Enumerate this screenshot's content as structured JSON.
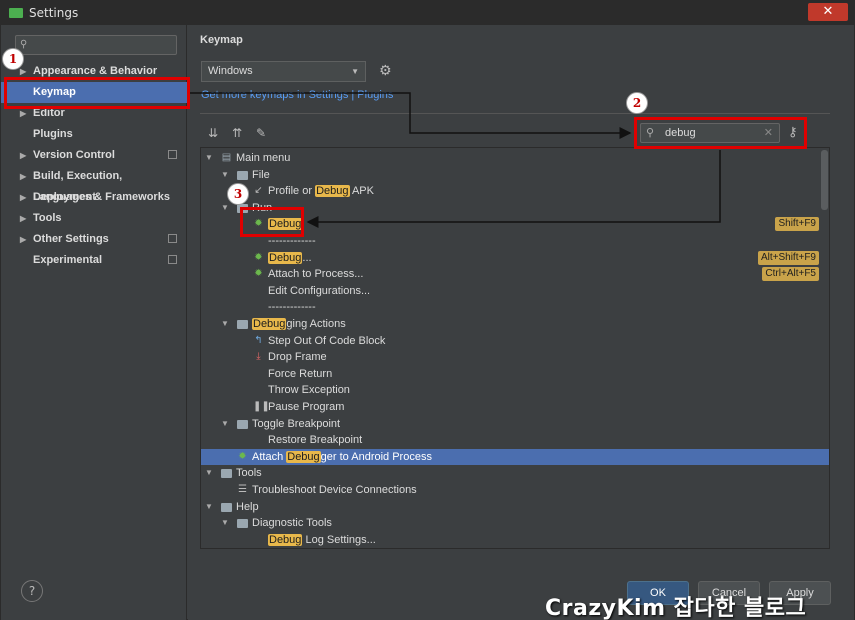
{
  "window": {
    "title": "Settings",
    "close_label": "✕"
  },
  "sidebar": {
    "search_placeholder": "",
    "items": [
      {
        "label": "Appearance & Behavior",
        "expandable": true,
        "project": false
      },
      {
        "label": "Keymap",
        "expandable": false,
        "project": false,
        "selected": true
      },
      {
        "label": "Editor",
        "expandable": true,
        "project": false
      },
      {
        "label": "Plugins",
        "expandable": false,
        "project": false
      },
      {
        "label": "Version Control",
        "expandable": true,
        "project": true
      },
      {
        "label": "Build, Execution, Deployment",
        "expandable": true,
        "project": false
      },
      {
        "label": "Languages & Frameworks",
        "expandable": true,
        "project": false
      },
      {
        "label": "Tools",
        "expandable": true,
        "project": false
      },
      {
        "label": "Other Settings",
        "expandable": true,
        "project": true
      },
      {
        "label": "Experimental",
        "expandable": false,
        "project": true
      }
    ],
    "help_label": "?"
  },
  "main": {
    "title": "Keymap",
    "keymap_value": "Windows",
    "link_text": "Get more keymaps in Settings | Plugins",
    "filter_value": "debug"
  },
  "tree": [
    {
      "depth": 0,
      "toggle": "open",
      "icon": "menu",
      "parts": [
        [
          "Main menu",
          false
        ]
      ]
    },
    {
      "depth": 1,
      "toggle": "open",
      "icon": "folder",
      "parts": [
        [
          "File",
          false
        ]
      ]
    },
    {
      "depth": 2,
      "toggle": "none",
      "icon": "apk",
      "parts": [
        [
          "Profile or ",
          false
        ],
        [
          "Debug",
          true
        ],
        [
          " APK",
          false
        ]
      ]
    },
    {
      "depth": 1,
      "toggle": "open",
      "icon": "folder",
      "parts": [
        [
          "Run",
          false
        ]
      ]
    },
    {
      "depth": 2,
      "toggle": "none",
      "icon": "bug",
      "parts": [
        [
          "Debug",
          true
        ]
      ],
      "shortcut": "Shift+F9"
    },
    {
      "depth": 2,
      "toggle": "none",
      "icon": "none",
      "parts": [
        [
          "-------------",
          false
        ]
      ]
    },
    {
      "depth": 2,
      "toggle": "none",
      "icon": "bug",
      "parts": [
        [
          "Debug",
          true
        ],
        [
          "...",
          false
        ]
      ],
      "shortcut": "Alt+Shift+F9"
    },
    {
      "depth": 2,
      "toggle": "none",
      "icon": "attach",
      "parts": [
        [
          "Attach to Process...",
          false
        ]
      ],
      "shortcut": "Ctrl+Alt+F5"
    },
    {
      "depth": 2,
      "toggle": "none",
      "icon": "none",
      "parts": [
        [
          "Edit Configurations...",
          false
        ]
      ]
    },
    {
      "depth": 2,
      "toggle": "none",
      "icon": "none",
      "parts": [
        [
          "-------------",
          false
        ]
      ]
    },
    {
      "depth": 1,
      "toggle": "open",
      "icon": "folder",
      "parts": [
        [
          "Debug",
          true
        ],
        [
          "ging Actions",
          false
        ]
      ]
    },
    {
      "depth": 2,
      "toggle": "none",
      "icon": "stepout",
      "parts": [
        [
          "Step Out Of Code Block",
          false
        ]
      ]
    },
    {
      "depth": 2,
      "toggle": "none",
      "icon": "dropframe",
      "parts": [
        [
          "Drop Frame",
          false
        ]
      ]
    },
    {
      "depth": 2,
      "toggle": "none",
      "icon": "none",
      "parts": [
        [
          "Force Return",
          false
        ]
      ]
    },
    {
      "depth": 2,
      "toggle": "none",
      "icon": "none",
      "parts": [
        [
          "Throw Exception",
          false
        ]
      ]
    },
    {
      "depth": 2,
      "toggle": "none",
      "icon": "pause",
      "parts": [
        [
          "Pause Program",
          false
        ]
      ]
    },
    {
      "depth": 1,
      "toggle": "open",
      "icon": "folder",
      "parts": [
        [
          "Toggle Breakpoint",
          false
        ]
      ]
    },
    {
      "depth": 2,
      "toggle": "none",
      "icon": "none",
      "parts": [
        [
          "Restore Breakpoint",
          false
        ]
      ]
    },
    {
      "depth": 1,
      "toggle": "none",
      "icon": "androidbug",
      "parts": [
        [
          "Attach ",
          false
        ],
        [
          "Debug",
          true
        ],
        [
          "ger to Android Process",
          false
        ]
      ],
      "selected": true
    },
    {
      "depth": 0,
      "toggle": "open",
      "icon": "folder",
      "parts": [
        [
          "Tools",
          false
        ]
      ]
    },
    {
      "depth": 1,
      "toggle": "none",
      "icon": "list",
      "parts": [
        [
          "Troubleshoot Device Connections",
          false
        ]
      ]
    },
    {
      "depth": 0,
      "toggle": "open",
      "icon": "folder",
      "parts": [
        [
          "Help",
          false
        ]
      ]
    },
    {
      "depth": 1,
      "toggle": "open",
      "icon": "folder",
      "parts": [
        [
          "Diagnostic Tools",
          false
        ]
      ]
    },
    {
      "depth": 2,
      "toggle": "none",
      "icon": "none",
      "parts": [
        [
          "Debug",
          true
        ],
        [
          " Log Settings...",
          false
        ]
      ]
    }
  ],
  "buttons": {
    "ok": "OK",
    "cancel": "Cancel",
    "apply": "Apply"
  },
  "annotations": {
    "badge1": "1",
    "badge2": "2",
    "badge3": "3",
    "color": "#e00000"
  },
  "watermark": "CrazyKim 잡다한 블로그"
}
